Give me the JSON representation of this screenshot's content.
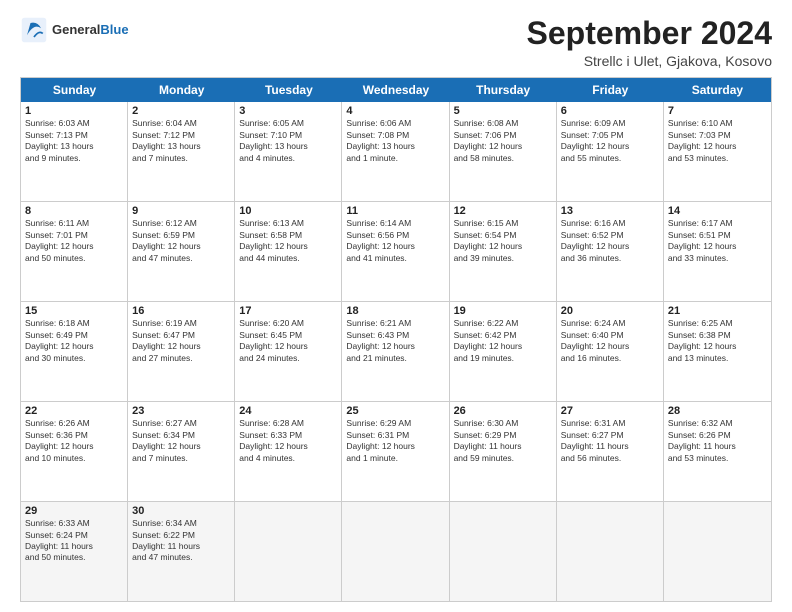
{
  "header": {
    "logo": {
      "general": "General",
      "blue": "Blue"
    },
    "title": "September 2024",
    "subtitle": "Strellc i Ulet, Gjakova, Kosovo"
  },
  "calendar": {
    "weekdays": [
      "Sunday",
      "Monday",
      "Tuesday",
      "Wednesday",
      "Thursday",
      "Friday",
      "Saturday"
    ],
    "rows": [
      [
        {
          "day": "1",
          "info": "Sunrise: 6:03 AM\nSunset: 7:13 PM\nDaylight: 13 hours\nand 9 minutes."
        },
        {
          "day": "2",
          "info": "Sunrise: 6:04 AM\nSunset: 7:12 PM\nDaylight: 13 hours\nand 7 minutes."
        },
        {
          "day": "3",
          "info": "Sunrise: 6:05 AM\nSunset: 7:10 PM\nDaylight: 13 hours\nand 4 minutes."
        },
        {
          "day": "4",
          "info": "Sunrise: 6:06 AM\nSunset: 7:08 PM\nDaylight: 13 hours\nand 1 minute."
        },
        {
          "day": "5",
          "info": "Sunrise: 6:08 AM\nSunset: 7:06 PM\nDaylight: 12 hours\nand 58 minutes."
        },
        {
          "day": "6",
          "info": "Sunrise: 6:09 AM\nSunset: 7:05 PM\nDaylight: 12 hours\nand 55 minutes."
        },
        {
          "day": "7",
          "info": "Sunrise: 6:10 AM\nSunset: 7:03 PM\nDaylight: 12 hours\nand 53 minutes."
        }
      ],
      [
        {
          "day": "8",
          "info": "Sunrise: 6:11 AM\nSunset: 7:01 PM\nDaylight: 12 hours\nand 50 minutes."
        },
        {
          "day": "9",
          "info": "Sunrise: 6:12 AM\nSunset: 6:59 PM\nDaylight: 12 hours\nand 47 minutes."
        },
        {
          "day": "10",
          "info": "Sunrise: 6:13 AM\nSunset: 6:58 PM\nDaylight: 12 hours\nand 44 minutes."
        },
        {
          "day": "11",
          "info": "Sunrise: 6:14 AM\nSunset: 6:56 PM\nDaylight: 12 hours\nand 41 minutes."
        },
        {
          "day": "12",
          "info": "Sunrise: 6:15 AM\nSunset: 6:54 PM\nDaylight: 12 hours\nand 39 minutes."
        },
        {
          "day": "13",
          "info": "Sunrise: 6:16 AM\nSunset: 6:52 PM\nDaylight: 12 hours\nand 36 minutes."
        },
        {
          "day": "14",
          "info": "Sunrise: 6:17 AM\nSunset: 6:51 PM\nDaylight: 12 hours\nand 33 minutes."
        }
      ],
      [
        {
          "day": "15",
          "info": "Sunrise: 6:18 AM\nSunset: 6:49 PM\nDaylight: 12 hours\nand 30 minutes."
        },
        {
          "day": "16",
          "info": "Sunrise: 6:19 AM\nSunset: 6:47 PM\nDaylight: 12 hours\nand 27 minutes."
        },
        {
          "day": "17",
          "info": "Sunrise: 6:20 AM\nSunset: 6:45 PM\nDaylight: 12 hours\nand 24 minutes."
        },
        {
          "day": "18",
          "info": "Sunrise: 6:21 AM\nSunset: 6:43 PM\nDaylight: 12 hours\nand 21 minutes."
        },
        {
          "day": "19",
          "info": "Sunrise: 6:22 AM\nSunset: 6:42 PM\nDaylight: 12 hours\nand 19 minutes."
        },
        {
          "day": "20",
          "info": "Sunrise: 6:24 AM\nSunset: 6:40 PM\nDaylight: 12 hours\nand 16 minutes."
        },
        {
          "day": "21",
          "info": "Sunrise: 6:25 AM\nSunset: 6:38 PM\nDaylight: 12 hours\nand 13 minutes."
        }
      ],
      [
        {
          "day": "22",
          "info": "Sunrise: 6:26 AM\nSunset: 6:36 PM\nDaylight: 12 hours\nand 10 minutes."
        },
        {
          "day": "23",
          "info": "Sunrise: 6:27 AM\nSunset: 6:34 PM\nDaylight: 12 hours\nand 7 minutes."
        },
        {
          "day": "24",
          "info": "Sunrise: 6:28 AM\nSunset: 6:33 PM\nDaylight: 12 hours\nand 4 minutes."
        },
        {
          "day": "25",
          "info": "Sunrise: 6:29 AM\nSunset: 6:31 PM\nDaylight: 12 hours\nand 1 minute."
        },
        {
          "day": "26",
          "info": "Sunrise: 6:30 AM\nSunset: 6:29 PM\nDaylight: 11 hours\nand 59 minutes."
        },
        {
          "day": "27",
          "info": "Sunrise: 6:31 AM\nSunset: 6:27 PM\nDaylight: 11 hours\nand 56 minutes."
        },
        {
          "day": "28",
          "info": "Sunrise: 6:32 AM\nSunset: 6:26 PM\nDaylight: 11 hours\nand 53 minutes."
        }
      ],
      [
        {
          "day": "29",
          "info": "Sunrise: 6:33 AM\nSunset: 6:24 PM\nDaylight: 11 hours\nand 50 minutes."
        },
        {
          "day": "30",
          "info": "Sunrise: 6:34 AM\nSunset: 6:22 PM\nDaylight: 11 hours\nand 47 minutes."
        },
        {
          "day": "",
          "info": ""
        },
        {
          "day": "",
          "info": ""
        },
        {
          "day": "",
          "info": ""
        },
        {
          "day": "",
          "info": ""
        },
        {
          "day": "",
          "info": ""
        }
      ]
    ]
  }
}
